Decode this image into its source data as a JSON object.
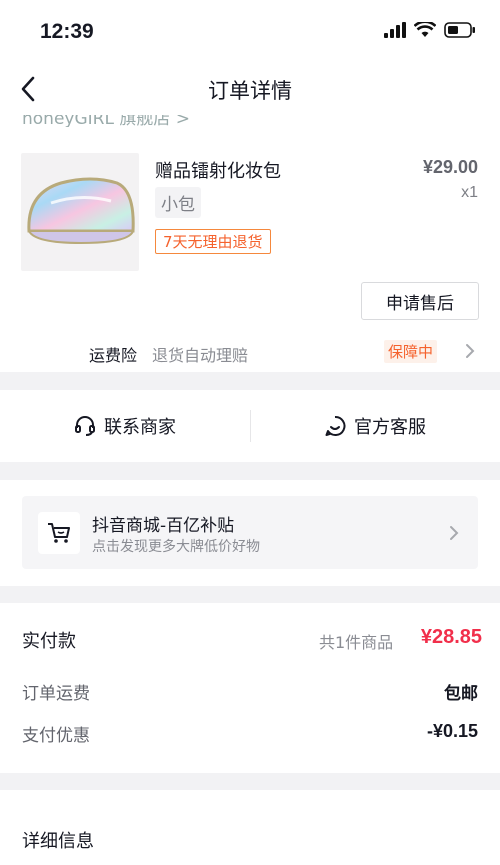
{
  "status_bar": {
    "time": "12:39"
  },
  "nav": {
    "title": "订单详情"
  },
  "store": {
    "name_partial": "honeyGIRL 旗舰店 >"
  },
  "product": {
    "name": "赠品镭射化妆包",
    "variant": "小包",
    "tag": "7天无理由退货",
    "price": "¥29.00",
    "qty": "x1",
    "after_sales_label": "申请售后"
  },
  "insurance": {
    "label": "运费险",
    "desc": "退货自动理赔",
    "badge": "保障中"
  },
  "contact": {
    "merchant_label": "联系商家",
    "service_label": "官方客服"
  },
  "promo": {
    "title": "抖音商城-百亿补贴",
    "subtitle": "点击发现更多大牌低价好物"
  },
  "payment": {
    "paid_label": "实付款",
    "items_count": "共1件商品",
    "paid_amount": "¥28.85",
    "shipping_label": "订单运费",
    "shipping_value": "包邮",
    "discount_label": "支付优惠",
    "discount_value": "-¥0.15"
  },
  "details": {
    "title": "详细信息"
  },
  "colors": {
    "price_red": "#f12f4b",
    "orange": "#f5622d",
    "text": "#161823"
  }
}
